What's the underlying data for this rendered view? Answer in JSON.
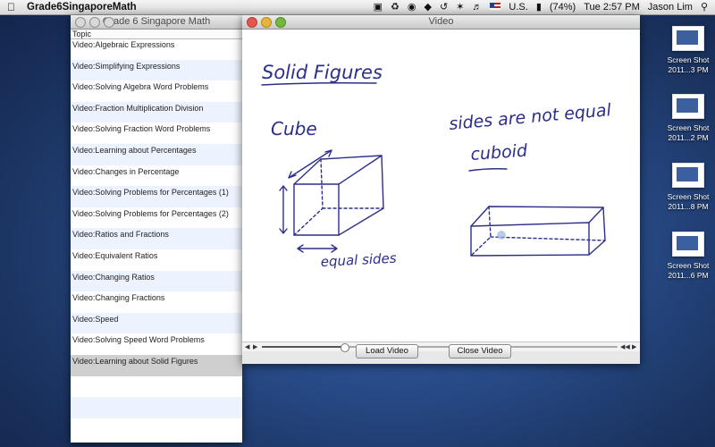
{
  "menubar": {
    "app_name": "Grade6SingaporeMath",
    "battery": "(74%)",
    "input_source": "U.S.",
    "clock": "Tue 2:57 PM",
    "user": "Jason Lim"
  },
  "topic_window": {
    "title": "Grade 6 Singapore Math",
    "column_header": "Topic",
    "selected_index": 15,
    "items": [
      "Video:Algebraic Expressions",
      "Video:Simplifying Expressions",
      "Video:Solving Algebra Word Problems",
      "Video:Fraction Multiplication Division",
      "Video:Solving Fraction Word Problems",
      "Video:Learning about Percentages",
      "Video:Changes in Percentage",
      "Video:Solving Problems for Percentages (1)",
      "Video:Solving Problems for Percentages (2)",
      "Video:Ratios and Fractions",
      "Video:Equivalent Ratios",
      "Video:Changing Ratios",
      "Video:Changing Fractions",
      "Video:Speed",
      "Video:Solving Speed Word Problems",
      "Video:Learning about Solid Figures"
    ]
  },
  "video_window": {
    "title": "Video",
    "playback_progress": 0.23,
    "load_button": "Load Video",
    "close_button": "Close Video",
    "whiteboard": {
      "heading": "Solid Figures",
      "cube_label": "Cube",
      "cube_note": "equal sides",
      "cuboid_note": "sides are not equal",
      "cuboid_label": "cuboid",
      "ink_color": "#2c2f8a"
    }
  },
  "desktop_icons": [
    {
      "line1": "Screen Shot",
      "line2": "2011...3 PM"
    },
    {
      "line1": "Screen Shot",
      "line2": "2011...2 PM"
    },
    {
      "line1": "Screen Shot",
      "line2": "2011...8 PM"
    },
    {
      "line1": "Screen Shot",
      "line2": "2011...6 PM"
    }
  ]
}
